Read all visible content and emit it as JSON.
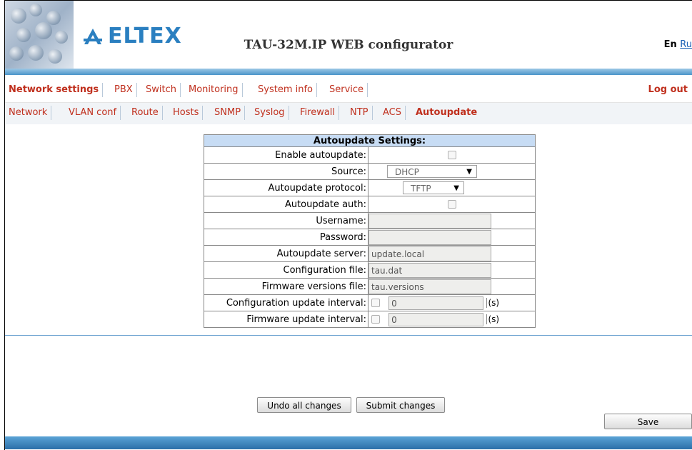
{
  "header": {
    "brand": "ELTEX",
    "title": "TAU-32M.IP WEB configurator",
    "lang_en": "En",
    "lang_ru": "Ru"
  },
  "menu_main": {
    "items": [
      "Network settings",
      "PBX",
      "Switch",
      "Monitoring",
      "System info",
      "Service"
    ],
    "logout": "Log out"
  },
  "menu_sub": {
    "items": [
      "Network",
      "VLAN conf",
      "Route",
      "Hosts",
      "SNMP",
      "Syslog",
      "Firewall",
      "NTP",
      "ACS",
      "Autoupdate"
    ]
  },
  "form": {
    "heading": "Autoupdate Settings:",
    "enable_label": "Enable autoupdate:",
    "source_label": "Source:",
    "source_value": "DHCP",
    "protocol_label": "Autoupdate protocol:",
    "protocol_value": "TFTP",
    "auth_label": "Autoupdate auth:",
    "username_label": "Username:",
    "username_value": "",
    "password_label": "Password:",
    "password_value": "",
    "server_label": "Autoupdate server:",
    "server_value": "update.local",
    "config_file_label": "Configuration file:",
    "config_file_value": "tau.dat",
    "fw_file_label": "Firmware versions file:",
    "fw_file_value": "tau.versions",
    "config_interval_label": "Configuration update interval:",
    "config_interval_value": "0",
    "fw_interval_label": "Firmware update interval:",
    "fw_interval_value": "0",
    "unit": "(s)"
  },
  "buttons": {
    "undo": "Undo all changes",
    "submit": "Submit changes",
    "save": "Save"
  },
  "colors": {
    "menu_text": "#c0301e",
    "accent_blue": "#2a7fc0",
    "header_row": "#c7dcf4"
  }
}
